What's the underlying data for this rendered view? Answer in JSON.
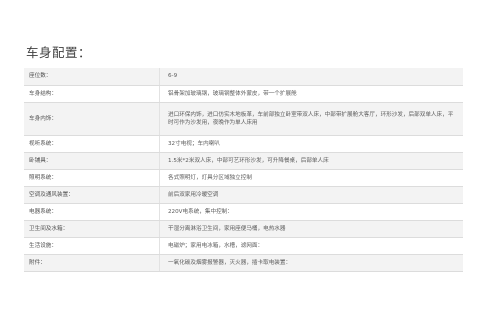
{
  "section_title": "车身配置：",
  "rows": [
    {
      "label": "座位数：",
      "value": "6-9"
    },
    {
      "label": "车身结构：",
      "value": "铝骨架加玻璃钢，玻璃钢整体外蒙皮，带一个扩展舱"
    },
    {
      "label": "车身内饰：",
      "value": "进口环保内饰，进口仿实木地板革，车前部独立卧室带双人床，中部带扩展舱大客厅，环形沙发，后部双单人床，平时可作为沙发用，夜晚作为单人床用"
    },
    {
      "label": "视听系统：",
      "value": "32寸电视；车内喇叭"
    },
    {
      "label": "卧铺具：",
      "value": "1.5米*2米双人床，中部可艺环形沙发，可升降餐桌，后部单人床"
    },
    {
      "label": "照明系统：",
      "value": "各式照明灯，灯具分区域独立控制"
    },
    {
      "label": "空调及通风装置：",
      "value": "前后双家用冷暖空调"
    },
    {
      "label": "电器系统：",
      "value": "220V电系统，集中控制："
    },
    {
      "label": "卫生间及水箱：",
      "value": "干湿分离淋浴卫生间，家用座便马桶，电热水器"
    },
    {
      "label": "生活设施：",
      "value": "电磁炉；家用电冰箱，水槽，滤网面："
    },
    {
      "label": "附件：",
      "value": "一氧化碳及烟雾报警器，灭火器，插卡取电装置："
    }
  ]
}
